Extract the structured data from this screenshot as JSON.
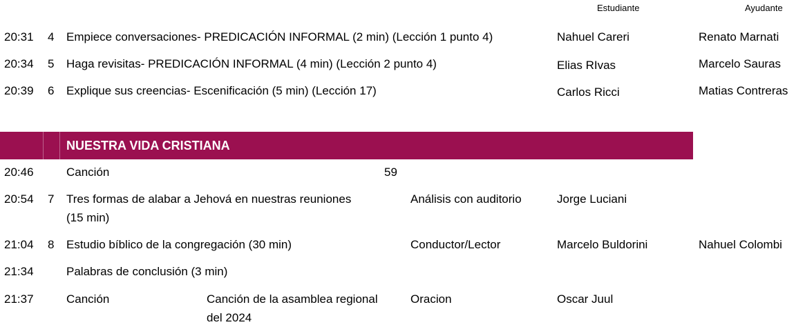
{
  "header": {
    "estudiante": "Estudiante",
    "ayudante": "Ayudante"
  },
  "ministry_rows": [
    {
      "time": "20:31",
      "num": "4",
      "title": "Empiece conversaciones- PREDICACIÓN INFORMAL (2 min) (Lección 1 punto 4)",
      "student": "Nahuel Careri",
      "helper": "Renato Marnati"
    },
    {
      "time": "20:34",
      "num": "5",
      "title": "Haga revisitas- PREDICACIÓN INFORMAL (4 min) (Lección 2 punto 4)",
      "student": "Elias RIvas",
      "helper": "Marcelo Sauras"
    },
    {
      "time": "20:39",
      "num": "6",
      "title": "Explique sus creencias- Escenificación (5 min) (Lección 17)",
      "student": "Carlos Ricci",
      "helper": "Matias Contreras"
    }
  ],
  "section": {
    "title": "NUESTRA VIDA CRISTIANA"
  },
  "christian_rows": [
    {
      "time": "20:46",
      "num": "",
      "title": "Canción",
      "song": "59",
      "role": "",
      "assignee": "",
      "assistant": ""
    },
    {
      "time": "20:54",
      "num": "7",
      "title_line1": "Tres formas de alabar a Jehová en nuestras reuniones",
      "title_line2": "(15 min)",
      "role": "Análisis con auditorio",
      "assignee": "Jorge Luciani",
      "assistant": ""
    },
    {
      "time": "21:04",
      "num": "8",
      "title": "Estudio bíblico de la congregación (30 min)",
      "role": "Conductor/Lector",
      "assignee": "Marcelo Buldorini",
      "assistant": "Nahuel Colombi"
    },
    {
      "time": "21:34",
      "num": "",
      "title": "Palabras de conclusión (3 min)",
      "role": "",
      "assignee": "",
      "assistant": ""
    },
    {
      "time": "21:37",
      "num": "",
      "title": "Canción",
      "song_line1": "Canción de la asamblea regional",
      "song_line2": "del 2024",
      "role": "Oracion",
      "assignee": "Oscar Juul",
      "assistant": ""
    }
  ]
}
